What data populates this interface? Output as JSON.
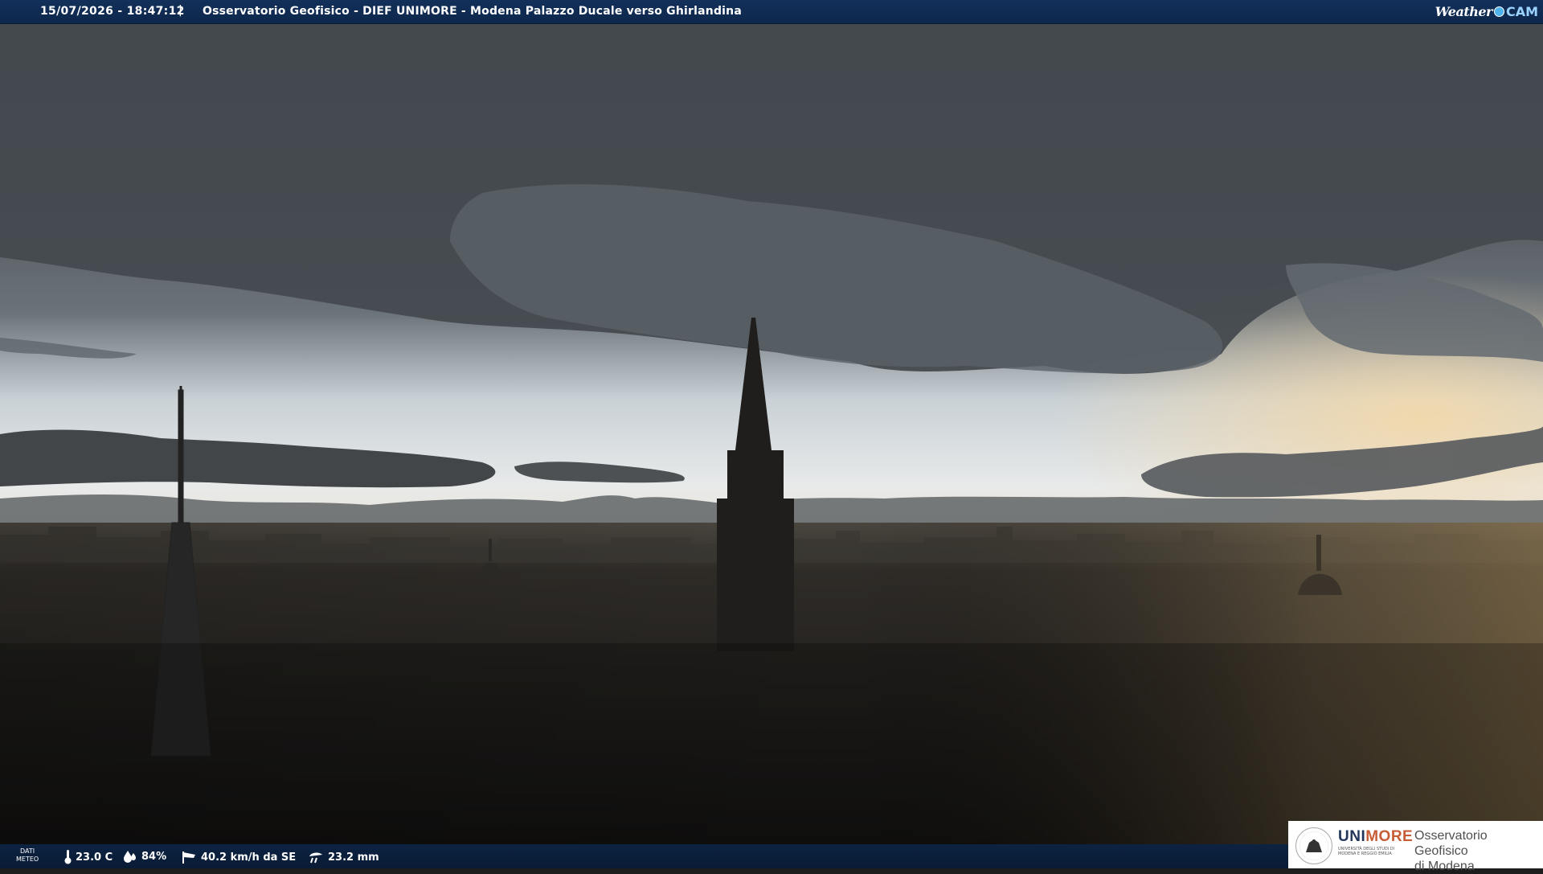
{
  "header": {
    "timestamp": "15/07/2026 - 18:47:12",
    "separator": "|",
    "title": "Osservatorio Geofisico - DIEF UNIMORE - Modena Palazzo Ducale verso Ghirlandina",
    "brand_left": "Weather",
    "brand_right": "CAM"
  },
  "weather": {
    "label_line1": "DATI",
    "label_line2": "METEO",
    "temperature": "23.0 C",
    "humidity": "84%",
    "wind": "40.2 km/h da SE",
    "rain": "23.2 mm",
    "icons": [
      "thermometer-icon",
      "humidity-drop-icon",
      "wind-sock-icon",
      "rain-gauge-icon"
    ]
  },
  "logo": {
    "uni": "UNI",
    "more": "MORE",
    "sub": "UNIVERSITÀ DEGLI STUDI DI MODENA E REGGIO EMILIA",
    "obs_line1": "Osservatorio Geofisico",
    "obs_line2": "di Modena"
  },
  "colors": {
    "bar_blue": "#0e274b",
    "accent_light_blue": "#4fb2ea",
    "unimore_blue": "#22365a",
    "unimore_orange": "#c75d35"
  }
}
